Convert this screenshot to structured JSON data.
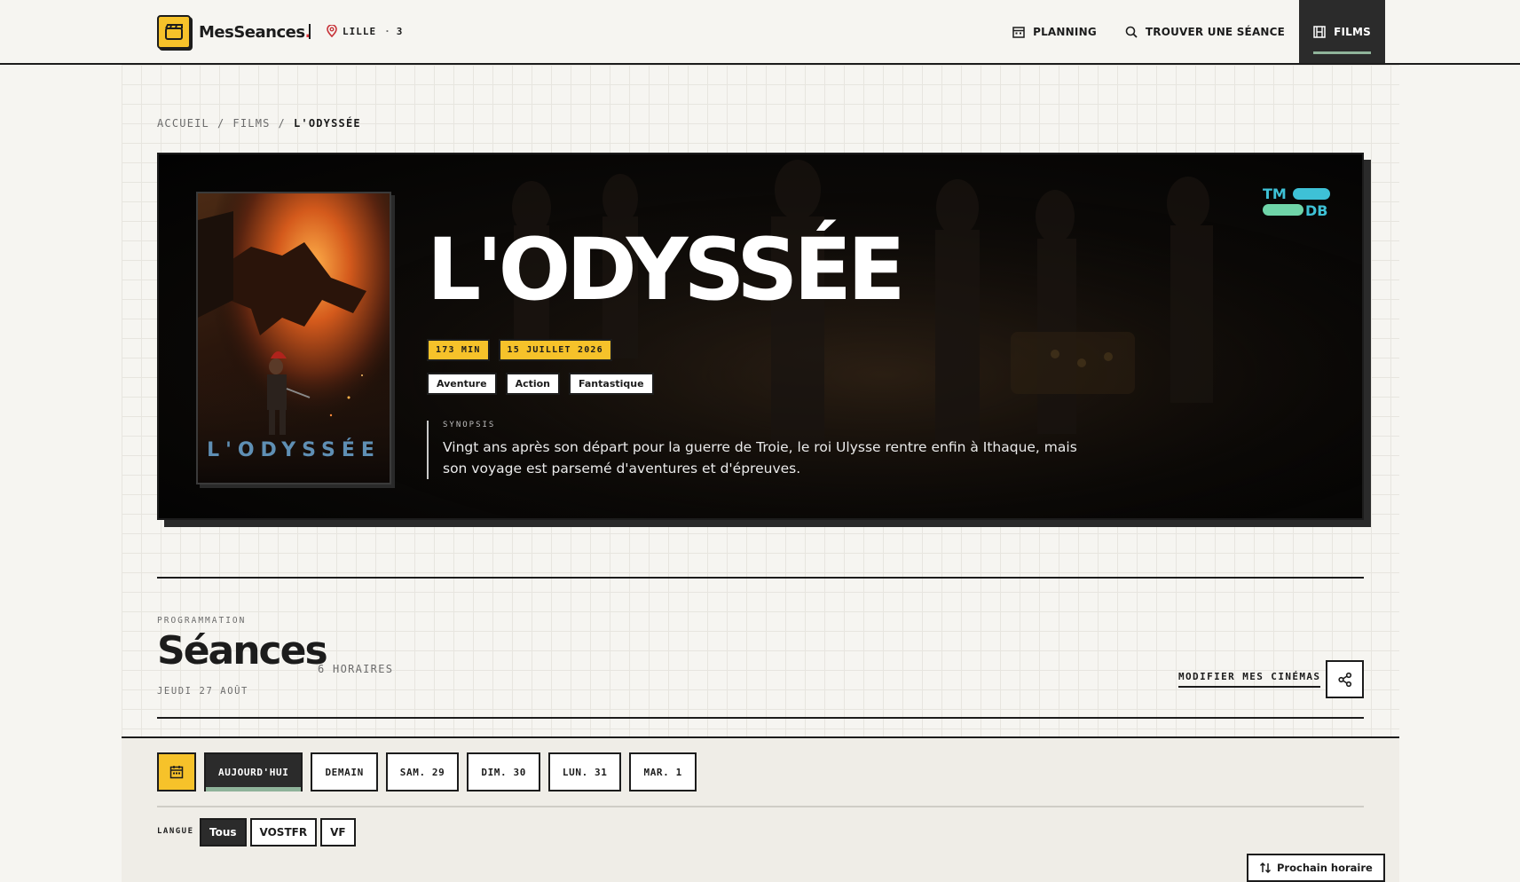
{
  "header": {
    "logo_text": "MesSeances",
    "logo_dot": ".",
    "location": "LILLE",
    "location_sep": "·",
    "location_count": "3",
    "nav": [
      {
        "label": "PLANNING",
        "icon": "calendar-icon"
      },
      {
        "label": "TROUVER UNE SÉANCE",
        "icon": "search-icon"
      },
      {
        "label": "FILMS",
        "icon": "film-icon",
        "active": true
      }
    ]
  },
  "breadcrumb": {
    "items": [
      "ACCUEIL",
      "/",
      "FILMS",
      "/"
    ],
    "current": "L'ODYSSÉE"
  },
  "film": {
    "title": "L'ODYSSÉE",
    "poster_title": "L'ODYSSÉE",
    "duration": "173 MIN",
    "release": "15 JUILLET 2026",
    "genres": [
      "Aventure",
      "Action",
      "Fantastique"
    ],
    "synopsis_label": "SYNOPSIS",
    "synopsis": "Vingt ans après son départ pour la guerre de Troie, le roi Ulysse rentre enfin à Ithaque, mais son voyage est parsemé d'aventures et d'épreuves.",
    "tmdb_top": "TM",
    "tmdb_bottom": "DB"
  },
  "seances": {
    "section_label": "PROGRAMMATION",
    "title": "Séances",
    "count": "6 HORAIRES",
    "date": "JEUDI 27 AOÛT",
    "modify_label": "MODIFIER MES CINÉMAS"
  },
  "days": [
    "AUJOURD'HUI",
    "DEMAIN",
    "SAM. 29",
    "DIM. 30",
    "LUN. 31",
    "MAR. 1"
  ],
  "language": {
    "label": "LANGUE",
    "options": [
      "Tous",
      "VOSTFR",
      "VF"
    ]
  },
  "sort_label": "Prochain horaire",
  "colors": {
    "accent_yellow": "#f6c22a",
    "dark": "#2b2b2b",
    "active_underline": "#8fb39a",
    "tmdb": "#3ec1d6"
  }
}
